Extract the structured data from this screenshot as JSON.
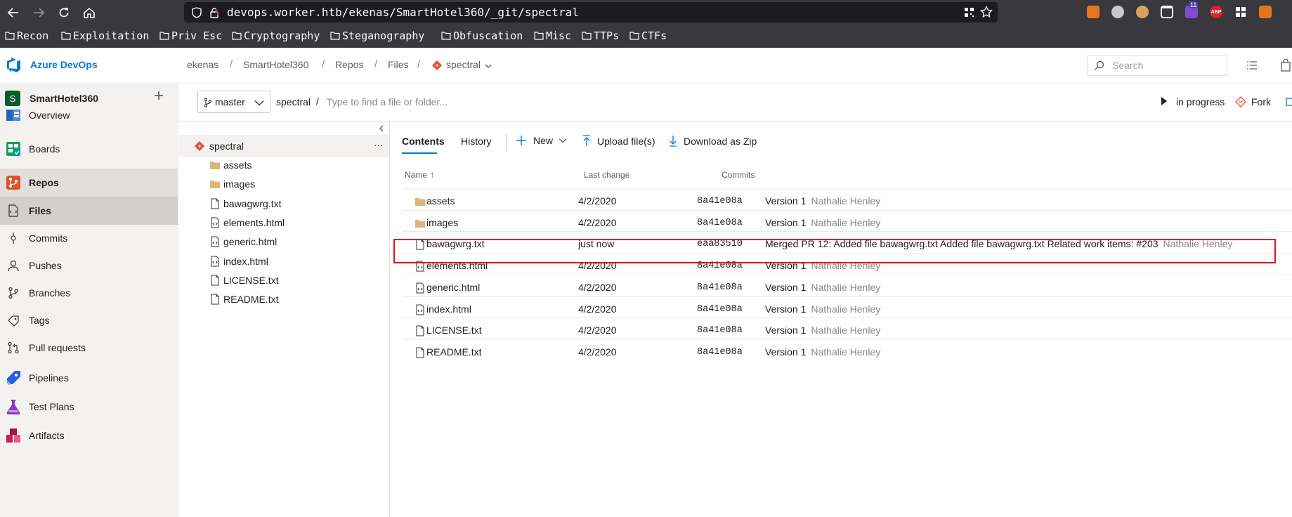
{
  "browser": {
    "url": "devops.worker.htb/ekenas/SmartHotel360/_git/spectral",
    "badge_count": "11",
    "abp_label": "ABP",
    "bookmarks": [
      "Recon",
      "Exploitation",
      "Priv Esc",
      "Cryptography",
      "Steganography",
      "Obfuscation",
      "Misc",
      "TTPs",
      "CTFs"
    ]
  },
  "header": {
    "brand": "Azure DevOps",
    "breadcrumb": [
      "ekenas",
      "SmartHotel360",
      "Repos",
      "Files",
      "spectral"
    ],
    "search_placeholder": "Search"
  },
  "sidebar": {
    "project_initial": "S",
    "project_name": "SmartHotel360",
    "add_label": "+",
    "items": [
      {
        "label": "Overview",
        "icon": "overview-icon"
      },
      {
        "label": "Boards",
        "icon": "boards-icon"
      },
      {
        "label": "Repos",
        "icon": "repos-icon",
        "selected": true
      },
      {
        "label": "Files",
        "icon": "files-icon",
        "active": true
      },
      {
        "label": "Commits",
        "icon": "commits-icon"
      },
      {
        "label": "Pushes",
        "icon": "pushes-icon"
      },
      {
        "label": "Branches",
        "icon": "branches-icon"
      },
      {
        "label": "Tags",
        "icon": "tags-icon"
      },
      {
        "label": "Pull requests",
        "icon": "pull-requests-icon"
      },
      {
        "label": "Pipelines",
        "icon": "pipelines-icon"
      },
      {
        "label": "Test Plans",
        "icon": "test-plans-icon"
      },
      {
        "label": "Artifacts",
        "icon": "artifacts-icon"
      }
    ]
  },
  "subheader": {
    "branch": "master",
    "repo": "spectral",
    "path_sep": "/",
    "find_placeholder": "Type to find a file or folder...",
    "status": "in progress",
    "fork_label": "Fork"
  },
  "tree": {
    "root": "spectral",
    "more": "...",
    "items": [
      {
        "label": "assets",
        "kind": "folder"
      },
      {
        "label": "images",
        "kind": "folder"
      },
      {
        "label": "bawagwrg.txt",
        "kind": "file"
      },
      {
        "label": "elements.html",
        "kind": "code"
      },
      {
        "label": "generic.html",
        "kind": "code"
      },
      {
        "label": "index.html",
        "kind": "code"
      },
      {
        "label": "LICENSE.txt",
        "kind": "file"
      },
      {
        "label": "README.txt",
        "kind": "file"
      }
    ]
  },
  "content": {
    "tabs": [
      "Contents",
      "History"
    ],
    "new_label": "New",
    "upload_label": "Upload file(s)",
    "download_label": "Download as Zip",
    "columns": {
      "name": "Name",
      "sort": "↑",
      "last_change": "Last change",
      "commits": "Commits"
    },
    "rows": [
      {
        "name": "assets",
        "kind": "folder",
        "date": "4/2/2020",
        "commit": "8a41e08a",
        "message": "Version 1",
        "author": "Nathalie Henley"
      },
      {
        "name": "images",
        "kind": "folder",
        "date": "4/2/2020",
        "commit": "8a41e08a",
        "message": "Version 1",
        "author": "Nathalie Henley"
      },
      {
        "name": "bawagwrg.txt",
        "kind": "file",
        "date": "just now",
        "commit": "eaa83510",
        "message": "Merged PR 12: Added file bawagwrg.txt Added file bawagwrg.txt Related work items: #203",
        "author": "Nathalie Henley"
      },
      {
        "name": "elements.html",
        "kind": "code",
        "date": "4/2/2020",
        "commit": "8a41e08a",
        "message": "Version 1",
        "author": "Nathalie Henley"
      },
      {
        "name": "generic.html",
        "kind": "code",
        "date": "4/2/2020",
        "commit": "8a41e08a",
        "message": "Version 1",
        "author": "Nathalie Henley"
      },
      {
        "name": "index.html",
        "kind": "code",
        "date": "4/2/2020",
        "commit": "8a41e08a",
        "message": "Version 1",
        "author": "Nathalie Henley"
      },
      {
        "name": "LICENSE.txt",
        "kind": "file",
        "date": "4/2/2020",
        "commit": "8a41e08a",
        "message": "Version 1",
        "author": "Nathalie Henley"
      },
      {
        "name": "README.txt",
        "kind": "file",
        "date": "4/2/2020",
        "commit": "8a41e08a",
        "message": "Version 1",
        "author": "Nathalie Henley"
      }
    ]
  },
  "colors": {
    "accent": "#0078d4",
    "highlight": "#e3101a",
    "sidebar_bg": "#f3f2f1",
    "selected_bg": "#e1dfdd"
  }
}
